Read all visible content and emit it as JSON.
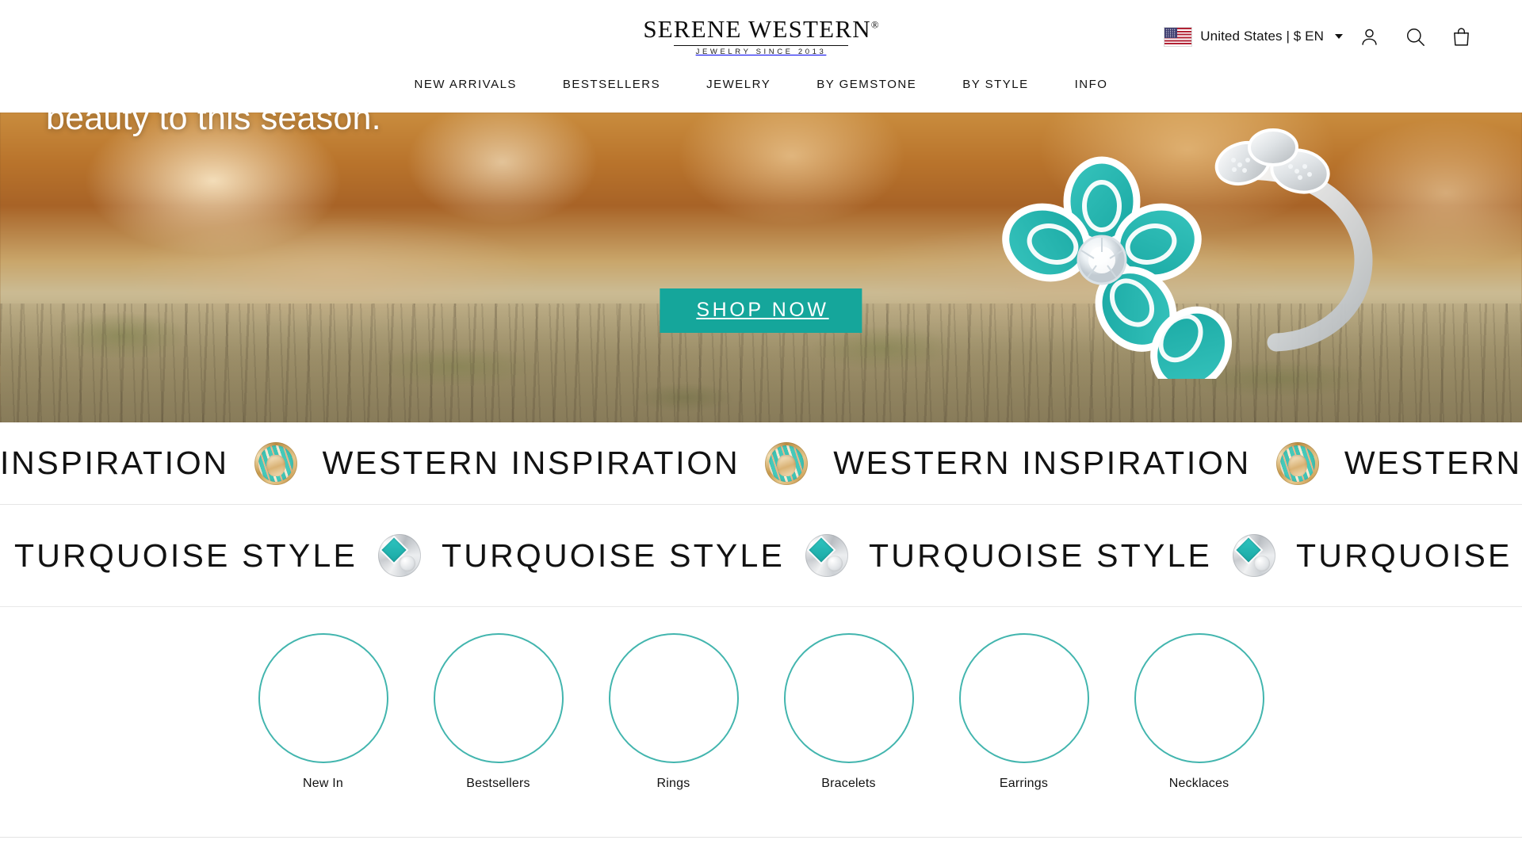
{
  "brand": {
    "name": "Serene Western",
    "logo_main": "SERENE WESTERN",
    "registered_mark": "®",
    "tagline": "JEWELRY SINCE 2013"
  },
  "header": {
    "locale": {
      "flag": "us-flag-icon",
      "label": "United States  |  $ EN",
      "caret": "chevron-down-icon"
    },
    "icons": [
      {
        "name": "account-icon",
        "label": "Account"
      },
      {
        "name": "search-icon",
        "label": "Search"
      },
      {
        "name": "cart-icon",
        "label": "Cart"
      }
    ]
  },
  "nav": {
    "items": [
      {
        "label": "NEW ARRIVALS"
      },
      {
        "label": "BESTSELLERS"
      },
      {
        "label": "JEWELRY"
      },
      {
        "label": "BY GEMSTONE"
      },
      {
        "label": "BY STYLE"
      },
      {
        "label": "INFO"
      }
    ]
  },
  "hero": {
    "headline": "beauty to this season.",
    "cta_label": "SHOP NOW",
    "cta_color": "#15a69b"
  },
  "marquee_top": {
    "text": "WESTERN INSPIRATION",
    "icon": "gold-turquoise-ring-icon",
    "repeat": 4
  },
  "marquee_bottom": {
    "text": "TURQUOISE STYLE",
    "icon": "silver-turquoise-ring-icon",
    "repeat": 5
  },
  "categories": {
    "accent_color": "#42b5ae",
    "items": [
      {
        "label": "New In",
        "image": "turquoise-split-shank-ring"
      },
      {
        "label": "Bestsellers",
        "image": "turquoise-halo-ring"
      },
      {
        "label": "Rings",
        "image": "turquoise-chevron-ring"
      },
      {
        "label": "Bracelets",
        "image": "turquoise-silver-cuff"
      },
      {
        "label": "Earrings",
        "image": "turquoise-feather-earrings"
      },
      {
        "label": "Necklaces",
        "image": "turquoise-swirl-necklace"
      }
    ]
  }
}
